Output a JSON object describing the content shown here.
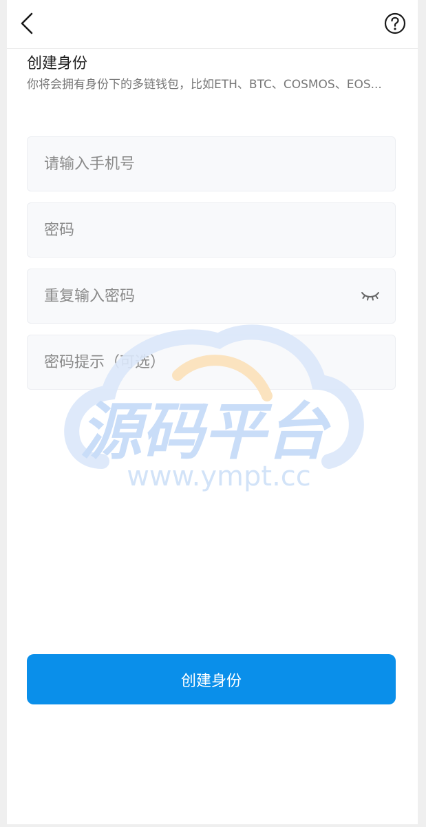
{
  "header": {
    "back_icon": "chevron-left-icon",
    "help_icon": "question-circle-icon"
  },
  "page": {
    "title": "创建身份",
    "subtitle": "你将会拥有身份下的多链钱包，比如ETH、BTC、COSMOS、EOS..."
  },
  "form": {
    "phone_placeholder": "请输入手机号",
    "password_placeholder": "密码",
    "repeat_password_placeholder": "重复输入密码",
    "hint_placeholder": "密码提示（可选）",
    "eye_icon": "eye-closed-icon"
  },
  "watermark": {
    "brand": "源码平台",
    "url": "www.ympt.cc"
  },
  "actions": {
    "create_label": "创建身份"
  },
  "colors": {
    "primary": "#0a8fea",
    "watermark_blue": "#c9ddf8",
    "watermark_orange": "#fbe3bf"
  }
}
